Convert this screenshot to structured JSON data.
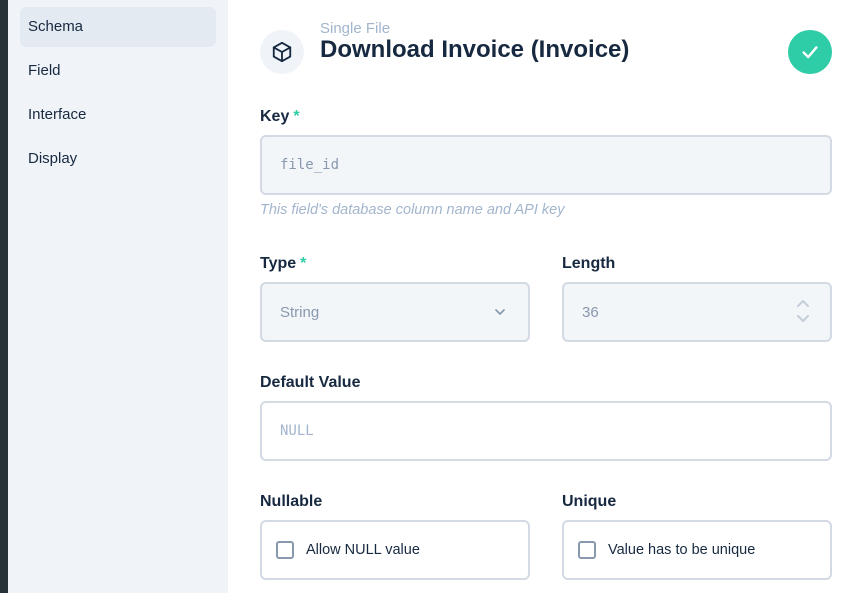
{
  "sidebar": {
    "items": [
      {
        "label": "Schema",
        "active": true
      },
      {
        "label": "Field",
        "active": false
      },
      {
        "label": "Interface",
        "active": false
      },
      {
        "label": "Display",
        "active": false
      }
    ]
  },
  "header": {
    "icon": "box-icon",
    "subtitle": "Single File",
    "title": "Download Invoice (Invoice)",
    "save_icon": "check-icon"
  },
  "form": {
    "key": {
      "label": "Key",
      "required": "*",
      "value": "file_id",
      "note": "This field's database column name and API key"
    },
    "type": {
      "label": "Type",
      "required": "*",
      "value": "String",
      "icon": "chevron-down-icon"
    },
    "length": {
      "label": "Length",
      "value": "36",
      "icon": "stepper-icon"
    },
    "default_value": {
      "label": "Default Value",
      "placeholder": "NULL"
    },
    "nullable": {
      "label": "Nullable",
      "checkbox_label": "Allow NULL value",
      "checked": false
    },
    "unique": {
      "label": "Unique",
      "checkbox_label": "Value has to be unique",
      "checked": false
    }
  },
  "colors": {
    "accent": "#2ecda7",
    "sidebar_bg": "#f0f4f9",
    "text": "#172940",
    "muted": "#a2b5cd",
    "border": "#d3dae4"
  }
}
